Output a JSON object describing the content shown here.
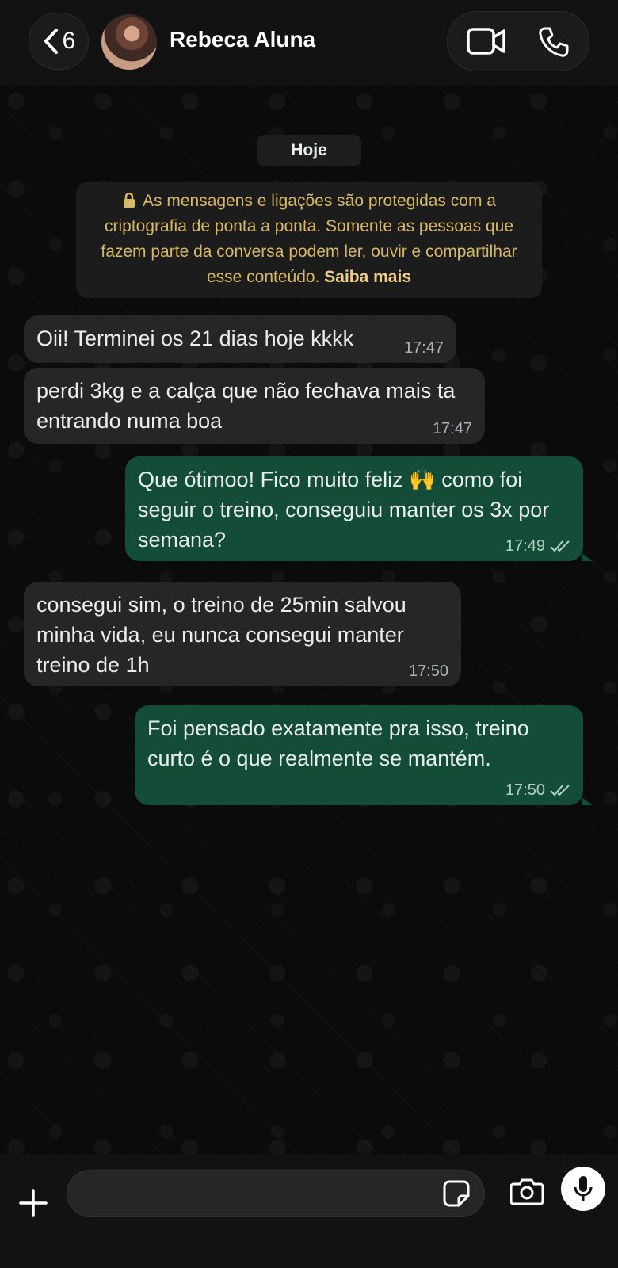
{
  "header": {
    "back_count": "6",
    "contact_name": "Rebeca Aluna"
  },
  "chat": {
    "date_label": "Hoje",
    "encryption_notice": "As mensagens e ligações são protegidas com a criptografia de ponta a ponta. Somente as pessoas que fazem parte da conversa podem ler, ouvir e compartilhar esse conteúdo.",
    "encryption_link": "Saiba mais",
    "messages": [
      {
        "direction": "in",
        "text": "Oii! Terminei os 21 dias hoje kkkk",
        "time": "17:47"
      },
      {
        "direction": "in",
        "text": "perdi 3kg e a calça que não fechava mais ta entrando numa boa",
        "time": "17:47"
      },
      {
        "direction": "out",
        "text": "Que ótimoo! Fico muito feliz 🙌 como foi seguir o treino, conseguiu manter os 3x por semana?",
        "time": "17:49",
        "status": "read"
      },
      {
        "direction": "in",
        "text": "consegui sim, o treino de 25min salvou minha vida, eu nunca consegui manter treino de 1h",
        "time": "17:50"
      },
      {
        "direction": "out",
        "text": "Foi pensado exatamente pra isso, treino curto é o que realmente se mantém.",
        "time": "17:50",
        "status": "read"
      }
    ]
  },
  "composer": {
    "placeholder": ""
  },
  "colors": {
    "incoming_bubble": "#262626",
    "outgoing_bubble": "#134d37",
    "notice_text": "#d8b865",
    "background": "#0b0b0b"
  },
  "icons": [
    "chevron-left-icon",
    "video-camera-icon",
    "phone-icon",
    "lock-icon",
    "double-check-icon",
    "plus-icon",
    "sticker-icon",
    "camera-icon",
    "microphone-icon"
  ]
}
